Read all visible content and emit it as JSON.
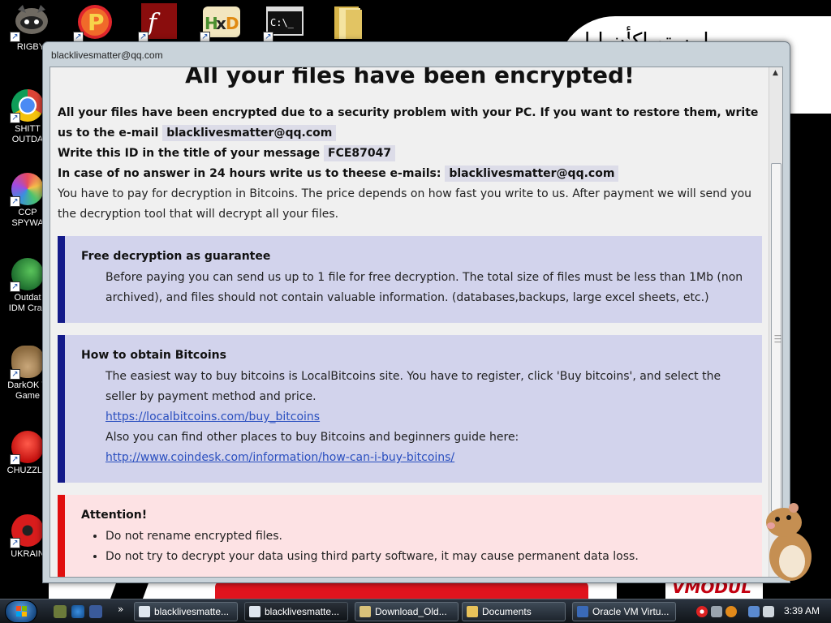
{
  "desktop": {
    "top_icons": [
      {
        "name": "raccoon-app-icon",
        "label": "RIGBY"
      },
      {
        "name": "p-app-icon"
      },
      {
        "name": "flash-icon"
      },
      {
        "name": "hxd-icon"
      },
      {
        "name": "cmd-icon"
      },
      {
        "name": "folder-icon"
      }
    ],
    "left_icons": [
      {
        "name": "chrome-icon",
        "label": [
          "SHITT",
          "OUTDA"
        ]
      },
      {
        "name": "ccleaner-icon",
        "label": [
          "CCP",
          "SPYWA"
        ]
      },
      {
        "name": "idm-icon",
        "label": [
          "Outdat",
          "IDM Crac"
        ]
      },
      {
        "name": "money-bag-icon",
        "label": [
          "DarkOK V",
          "Game"
        ]
      },
      {
        "name": "chuzzle-icon",
        "label": [
          "CHUZZLE"
        ]
      },
      {
        "name": "radiation-icon",
        "label": [
          "UKRAIN"
        ]
      }
    ],
    "wall_text": "VMODUL",
    "wall_scribble": "ابيستو اكأن ليا"
  },
  "window": {
    "title": "blacklivesmatter@qq.com"
  },
  "note": {
    "heading": "All your files have been encrypted!",
    "intro_1": "All your files have been encrypted due to a security problem with your PC. If you want to restore them, write us to the e-mail",
    "email": "blacklivesmatter@qq.com",
    "id_label": "Write this ID in the title of your message",
    "id_value": "FCE87047",
    "no_answer_label": "In case of no answer in 24 hours write us to theese e-mails:",
    "backup_email": "blacklivesmatter@qq.com",
    "pay_text": "You have to pay for decryption in Bitcoins. The price depends on how fast you write to us. After payment we will send you the decryption tool that will decrypt all your files.",
    "free": {
      "title": "Free decryption as guarantee",
      "text": "Before paying you can send us up to 1 file for free decryption. The total size of files must be less than 1Mb (non archived), and files should not contain valuable information. (databases,backups, large excel sheets, etc.)"
    },
    "bitcoins": {
      "title": "How to obtain Bitcoins",
      "text_1": "The easiest way to buy bitcoins is LocalBitcoins site. You have to register, click 'Buy bitcoins', and select the seller by payment method and price.",
      "link_1": "https://localbitcoins.com/buy_bitcoins",
      "text_2": "Also you can find other places to buy Bitcoins and beginners guide here:",
      "link_2": "http://www.coindesk.com/information/how-can-i-buy-bitcoins/"
    },
    "attention": {
      "title": "Attention!",
      "items": [
        "Do not rename encrypted files.",
        "Do not try to decrypt your data using third party software, it may cause permanent data loss."
      ]
    }
  },
  "taskbar": {
    "buttons": [
      {
        "label": "blacklivesmatte...",
        "icon": "html-file-icon"
      },
      {
        "label": "blacklivesmatte...",
        "icon": "html-file-icon"
      },
      {
        "label": "Download_Old...",
        "icon": "ie-icon"
      },
      {
        "label": "Documents",
        "icon": "folder-icon"
      },
      {
        "label": "Oracle VM Virtu...",
        "icon": "virtualbox-icon"
      }
    ],
    "clock": "3:39 AM"
  },
  "colors": {
    "blue_box_bg": "#d2d3ec",
    "blue_box_bar": "#141a8a",
    "red_box_bg": "#fde2e4",
    "red_box_bar": "#e10e0e",
    "link": "#2a4fbf"
  }
}
